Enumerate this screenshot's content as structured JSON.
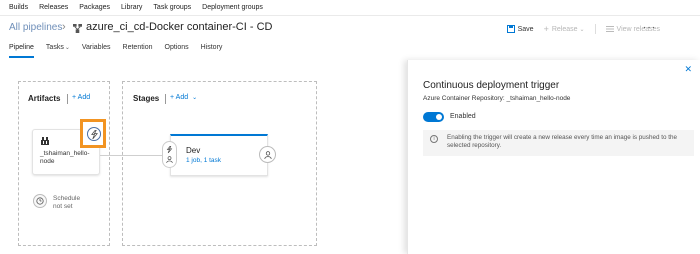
{
  "topnav": {
    "items": [
      "Builds",
      "Releases",
      "Packages",
      "Library",
      "Task groups",
      "Deployment groups"
    ]
  },
  "header": {
    "breadcrumb": "All pipelines",
    "title": "azure_ci_cd-Docker container-CI - CD",
    "save_label": "Save",
    "release_label": "Release",
    "view_releases_label": "View releases",
    "more_label": "···"
  },
  "tabs": [
    {
      "label": "Pipeline",
      "active": true
    },
    {
      "label": "Tasks",
      "active": false
    },
    {
      "label": "Variables",
      "active": false
    },
    {
      "label": "Retention",
      "active": false
    },
    {
      "label": "Options",
      "active": false
    },
    {
      "label": "History",
      "active": false
    }
  ],
  "artifacts": {
    "title": "Artifacts",
    "add_label": "+ Add",
    "card_name": "_tshaiman_hello-node",
    "schedule_line1": "Schedule",
    "schedule_line2": "not set"
  },
  "stages": {
    "title": "Stages",
    "add_label": "+ Add",
    "stage_name": "Dev",
    "stage_sub": "1 job, 1 task"
  },
  "panel": {
    "title": "Continuous deployment trigger",
    "subtitle": "Azure Container Repository: _tshaiman_hello-node",
    "toggle_label": "Enabled",
    "toggle_on": true,
    "info_text": "Enabling the trigger will create a new release every time an image is pushed to the selected repository.",
    "close_label": "✕"
  },
  "colors": {
    "accent": "#0078d4",
    "highlight": "#f29422"
  }
}
